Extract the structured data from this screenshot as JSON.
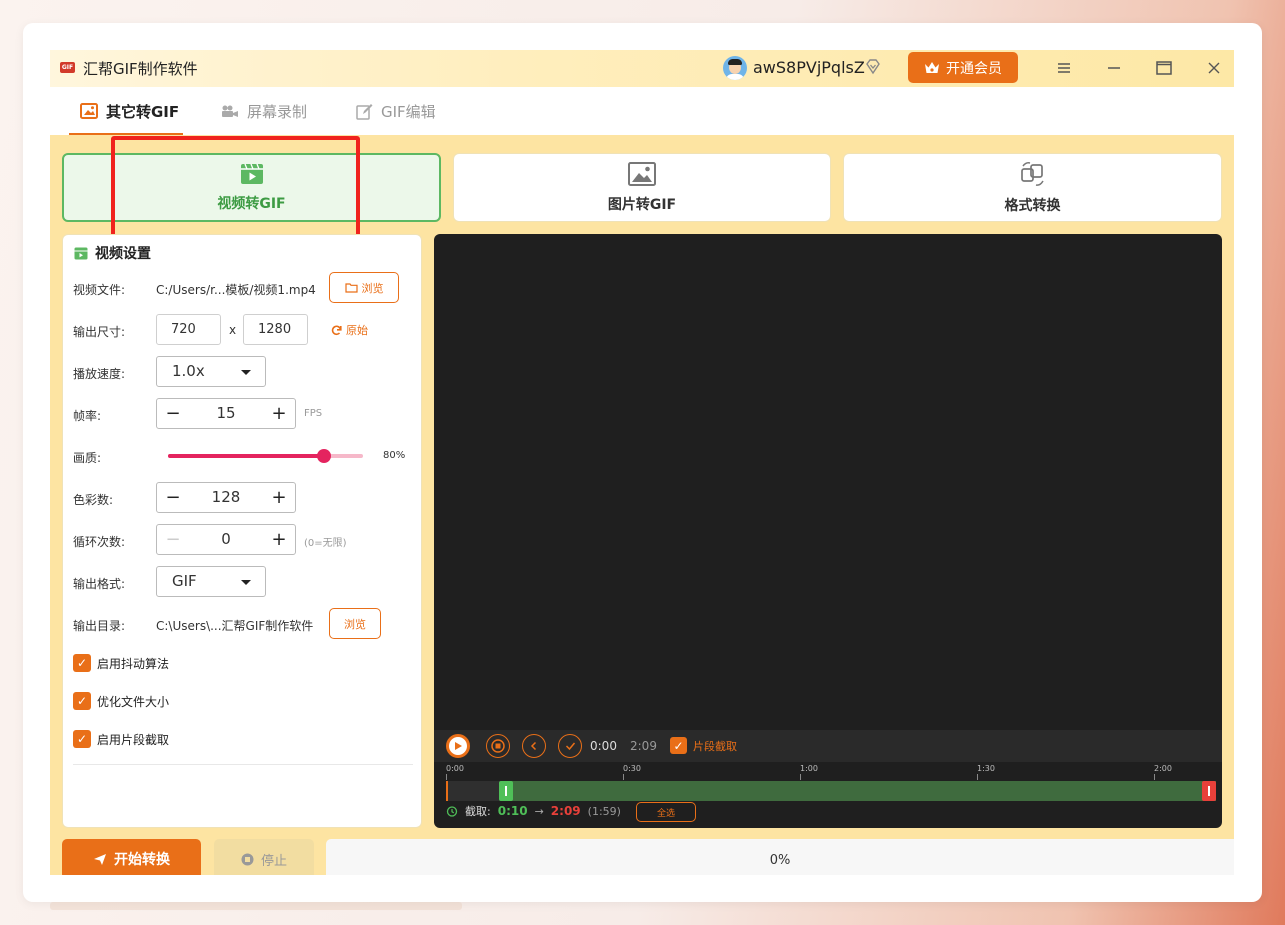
{
  "titlebar": {
    "app_icon_text": "GIF",
    "app_title": "汇帮GIF制作软件",
    "username": "awS8PVjPqlsZ",
    "member_button": "开通会员"
  },
  "tabs": [
    {
      "label": "其它转GIF",
      "active": true
    },
    {
      "label": "屏幕录制",
      "active": false
    },
    {
      "label": "GIF编辑",
      "active": false
    }
  ],
  "mode_cards": [
    {
      "label": "视频转GIF",
      "active": true
    },
    {
      "label": "图片转GIF",
      "active": false
    },
    {
      "label": "格式转换",
      "active": false
    }
  ],
  "settings": {
    "title": "视频设置",
    "video_file_label": "视频文件:",
    "video_file_value": "C:/Users/r...模板/视频1.mp4",
    "browse_label": "浏览",
    "output_size_label": "输出尺寸:",
    "width": "720",
    "x_label": "x",
    "height": "1280",
    "original_label": "原始",
    "speed_label": "播放速度:",
    "speed_value": "1.0x",
    "fps_label": "帧率:",
    "fps_value": "15",
    "fps_unit": "FPS",
    "quality_label": "画质:",
    "quality_value": "80%",
    "quality_fraction": 0.8,
    "colors_label": "色彩数:",
    "colors_value": "128",
    "loop_label": "循环次数:",
    "loop_value": "0",
    "loop_hint": "(0=无限)",
    "format_label": "输出格式:",
    "format_value": "GIF",
    "output_dir_label": "输出目录:",
    "output_dir_value": "C:\\Users\\...汇帮GIF制作软件",
    "output_browse_label": "浏览",
    "checkboxes": [
      {
        "label": "启用抖动算法",
        "checked": true
      },
      {
        "label": "优化文件大小",
        "checked": true
      },
      {
        "label": "启用片段截取",
        "checked": true
      }
    ]
  },
  "preview": {
    "current_time": "0:00",
    "total_time": "2:09",
    "segment_label": "片段截取",
    "ruler_ticks": [
      "0:00",
      "0:30",
      "1:00",
      "1:30",
      "2:00"
    ],
    "cut_label": "截取:",
    "cut_start": "0:10",
    "cut_arrow": "→",
    "cut_end": "2:09",
    "cut_duration": "(1:59)",
    "select_all": "全选",
    "duration_seconds": 129,
    "cut_start_seconds": 10,
    "cut_end_seconds": 129
  },
  "bottom": {
    "start_label": "开始转换",
    "stop_label": "停止",
    "progress_text": "0%"
  },
  "colors": {
    "accent": "#e96f18",
    "active_green": "#5db862",
    "highlight_red": "#f0231d",
    "quality_pink": "#e4245f"
  }
}
